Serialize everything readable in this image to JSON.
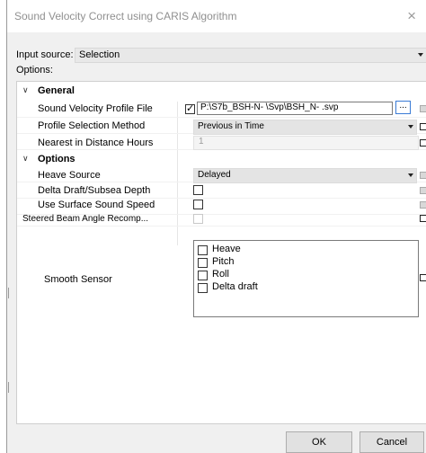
{
  "window": {
    "title": "Sound Velocity Correct using CARIS Algorithm",
    "close_glyph": "×"
  },
  "input_source": {
    "label": "Input source:",
    "value": "Selection"
  },
  "options_label": "Options:",
  "general": {
    "header": "General",
    "profile_file": {
      "label": "Sound Velocity Profile File",
      "checked": true,
      "path": "P:\\S7b_BSH-N-        \\Svp\\BSH_N-        .svp",
      "browse_label": "..."
    },
    "selection_method": {
      "label": "Profile Selection Method",
      "value": "Previous in Time"
    },
    "nearest_hours": {
      "label": "Nearest in Distance Hours",
      "value": "1"
    }
  },
  "options": {
    "header": "Options",
    "heave_source": {
      "label": "Heave Source",
      "value": "Delayed"
    },
    "delta_draft": {
      "label": "Delta Draft/Subsea Depth",
      "checked": false
    },
    "surface_sound_speed": {
      "label": "Use Surface Sound Speed",
      "checked": false
    },
    "steered_beam": {
      "label": "Steered Beam Angle Recomp...",
      "checked": false
    },
    "smooth_sensor": {
      "label": "Smooth Sensor",
      "items": [
        {
          "label": "Heave",
          "checked": false
        },
        {
          "label": "Pitch",
          "checked": false
        },
        {
          "label": "Roll",
          "checked": false
        },
        {
          "label": "Delta draft",
          "checked": false
        }
      ]
    }
  },
  "buttons": {
    "ok": "OK",
    "cancel": "Cancel"
  },
  "icons": {
    "collapse": "chevron-down-icon",
    "dropdown": "triangle-down-icon",
    "check": "checkmark-icon"
  }
}
